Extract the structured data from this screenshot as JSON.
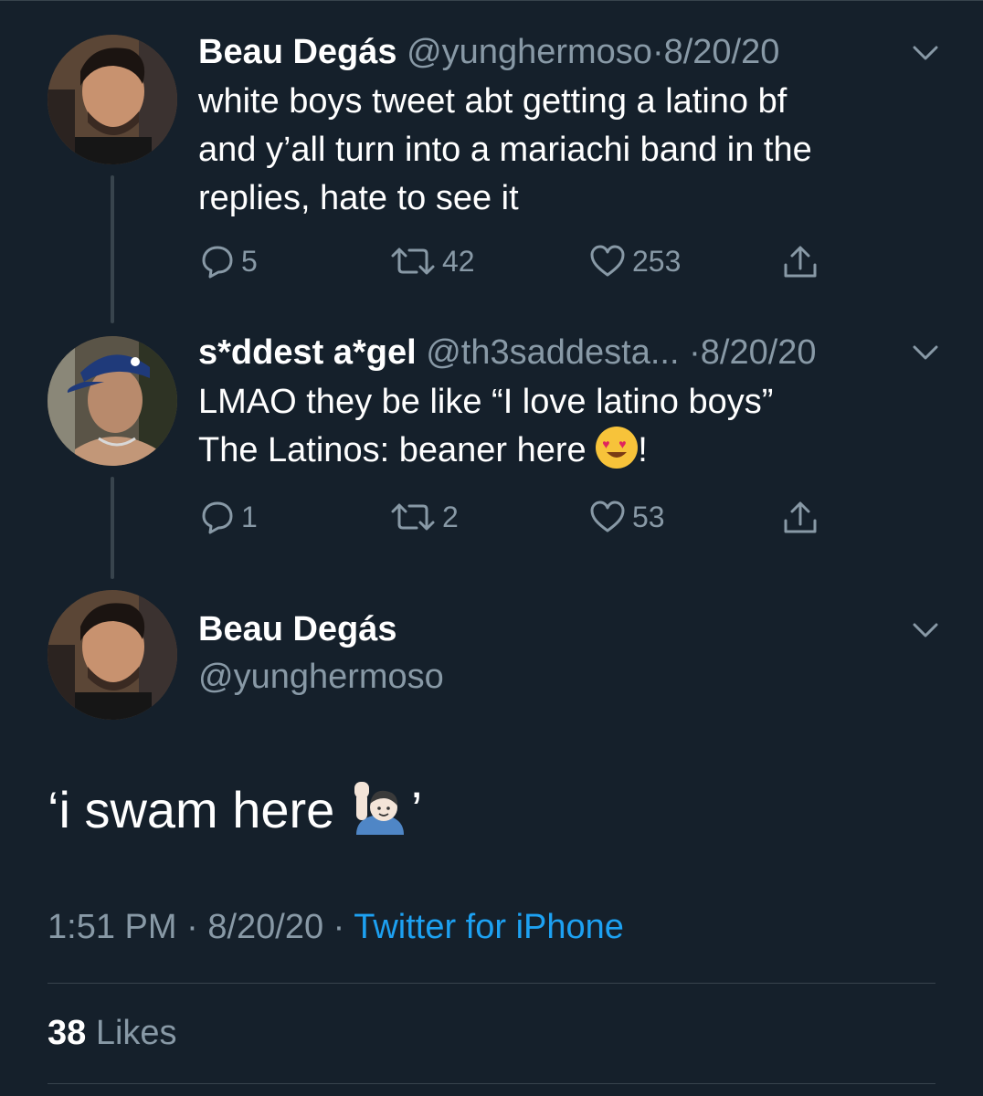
{
  "tweets": [
    {
      "name": "Beau Degás",
      "handle": "@yunghermoso",
      "date": "8/20/20",
      "lines": [
        "white boys tweet abt getting a latino bf",
        "and y’all turn into a mariachi band in the",
        "replies, hate to see it"
      ],
      "replies": "5",
      "retweets": "42",
      "likes": "253"
    },
    {
      "name": "s*ddest a*gel",
      "handle": "@th3saddesta...",
      "date": "8/20/20",
      "line1": "LMAO they be like “I love latino boys”",
      "line2_text": "The Latinos: beaner here ",
      "line2_emoji": "smiling-face-with-heart-eyes",
      "line2_suffix": "!",
      "replies": "1",
      "retweets": "2",
      "likes": "53"
    }
  ],
  "main_tweet": {
    "name": "Beau Degás",
    "handle": "@yunghermoso",
    "text_prefix": "‘i swam here ",
    "text_emoji": "person-raising-hand",
    "text_suffix": "’",
    "time": "1:51 PM",
    "date": "8/20/20",
    "sep": "·",
    "source": "Twitter for iPhone",
    "likes_count": "38",
    "likes_label": "Likes"
  },
  "colors": {
    "background": "#15202b",
    "muted": "#8899a6",
    "accent": "#1da1f2",
    "border": "#38444d"
  }
}
